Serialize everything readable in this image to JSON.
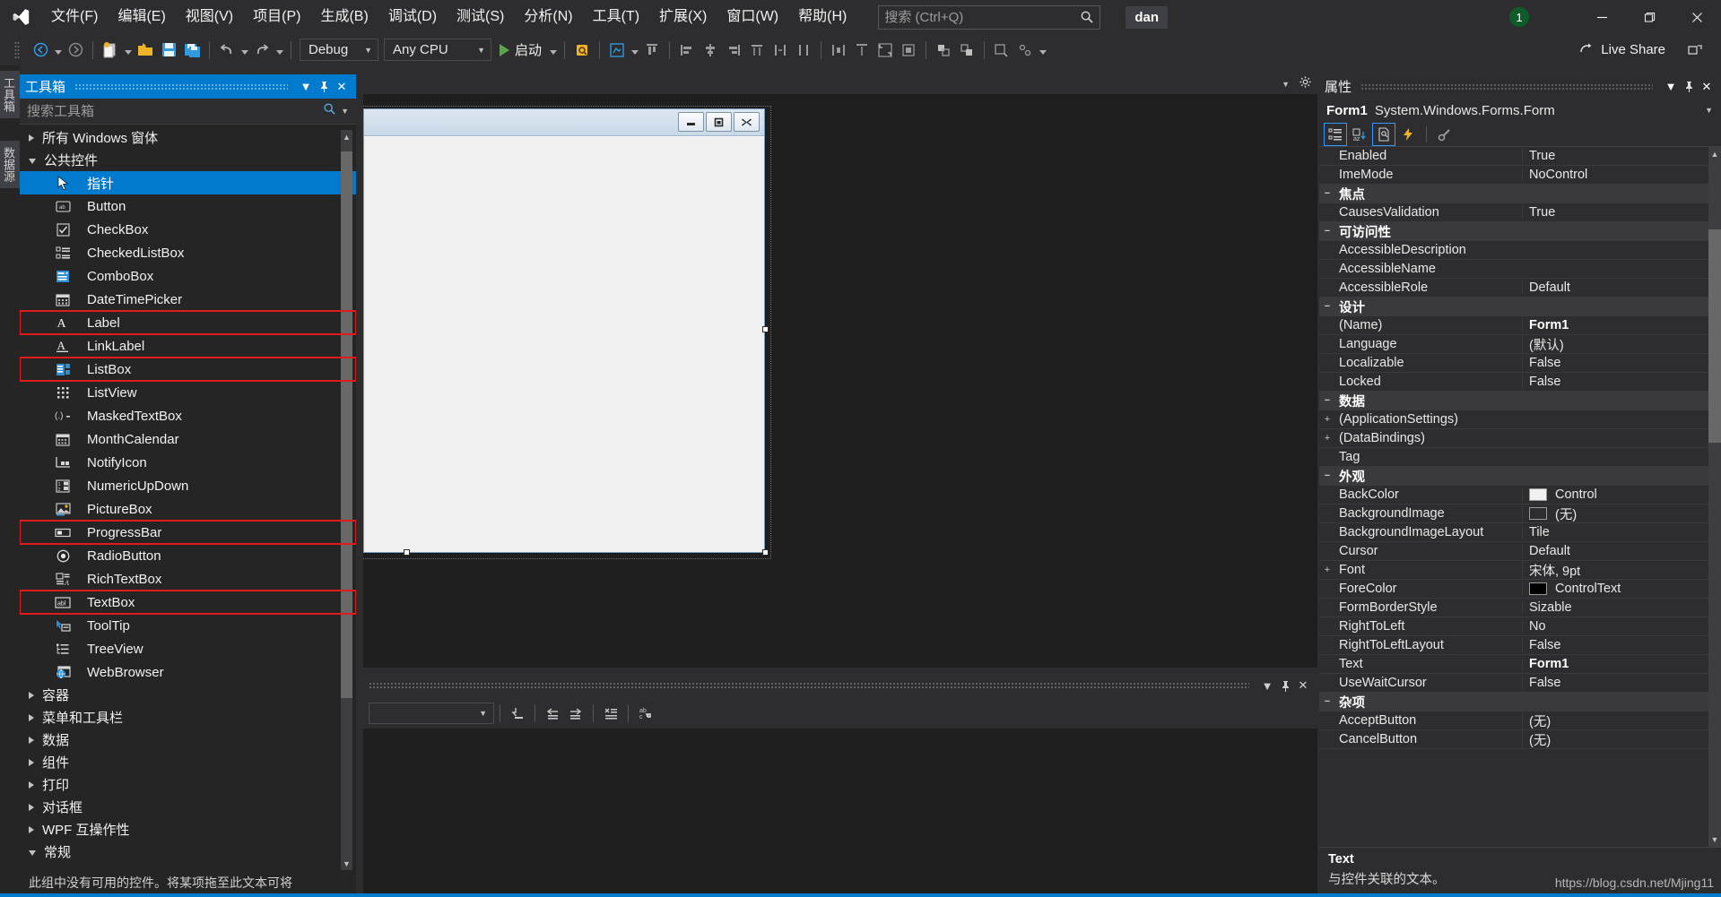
{
  "app": {
    "menu": [
      {
        "label": "文件(F)"
      },
      {
        "label": "编辑(E)"
      },
      {
        "label": "视图(V)"
      },
      {
        "label": "项目(P)"
      },
      {
        "label": "生成(B)"
      },
      {
        "label": "调试(D)"
      },
      {
        "label": "测试(S)"
      },
      {
        "label": "分析(N)"
      },
      {
        "label": "工具(T)"
      },
      {
        "label": "扩展(X)"
      },
      {
        "label": "窗口(W)"
      },
      {
        "label": "帮助(H)"
      }
    ],
    "search_placeholder": "搜索 (Ctrl+Q)",
    "user": "dan",
    "notification_count": "1",
    "window_buttons": {
      "minimize": "minimize-icon",
      "maximize": "maximize-icon",
      "close": "close-icon"
    }
  },
  "toolbar": {
    "configuration": "Debug",
    "platform": "Any CPU",
    "run_label": "启动",
    "live_share": "Live Share"
  },
  "vertical_tabs": [
    {
      "label": "工具箱"
    },
    {
      "label": "数据源"
    }
  ],
  "toolbox": {
    "title": "工具箱",
    "search_placeholder": "搜索工具箱",
    "groups": [
      {
        "label": "所有 Windows 窗体",
        "expanded": false
      },
      {
        "label": "公共控件",
        "expanded": true
      }
    ],
    "items": [
      {
        "label": "指针",
        "icon": "pointer-icon",
        "selected": true,
        "highlighted": false
      },
      {
        "label": "Button",
        "icon": "button-icon",
        "selected": false,
        "highlighted": false
      },
      {
        "label": "CheckBox",
        "icon": "checkbox-icon",
        "selected": false,
        "highlighted": false
      },
      {
        "label": "CheckedListBox",
        "icon": "checkedlistbox-icon",
        "selected": false,
        "highlighted": false
      },
      {
        "label": "ComboBox",
        "icon": "combobox-icon",
        "selected": false,
        "highlighted": false
      },
      {
        "label": "DateTimePicker",
        "icon": "datetimepicker-icon",
        "selected": false,
        "highlighted": false
      },
      {
        "label": "Label",
        "icon": "label-icon",
        "selected": false,
        "highlighted": true
      },
      {
        "label": "LinkLabel",
        "icon": "linklabel-icon",
        "selected": false,
        "highlighted": false
      },
      {
        "label": "ListBox",
        "icon": "listbox-icon",
        "selected": false,
        "highlighted": true
      },
      {
        "label": "ListView",
        "icon": "listview-icon",
        "selected": false,
        "highlighted": false
      },
      {
        "label": "MaskedTextBox",
        "icon": "maskedtextbox-icon",
        "selected": false,
        "highlighted": false
      },
      {
        "label": "MonthCalendar",
        "icon": "monthcalendar-icon",
        "selected": false,
        "highlighted": false
      },
      {
        "label": "NotifyIcon",
        "icon": "notifyicon-icon",
        "selected": false,
        "highlighted": false
      },
      {
        "label": "NumericUpDown",
        "icon": "numericupdown-icon",
        "selected": false,
        "highlighted": false
      },
      {
        "label": "PictureBox",
        "icon": "picturebox-icon",
        "selected": false,
        "highlighted": false
      },
      {
        "label": "ProgressBar",
        "icon": "progressbar-icon",
        "selected": false,
        "highlighted": true
      },
      {
        "label": "RadioButton",
        "icon": "radiobutton-icon",
        "selected": false,
        "highlighted": false
      },
      {
        "label": "RichTextBox",
        "icon": "richtextbox-icon",
        "selected": false,
        "highlighted": false
      },
      {
        "label": "TextBox",
        "icon": "textbox-icon",
        "selected": false,
        "highlighted": true
      },
      {
        "label": "ToolTip",
        "icon": "tooltip-icon",
        "selected": false,
        "highlighted": false
      },
      {
        "label": "TreeView",
        "icon": "treeview-icon",
        "selected": false,
        "highlighted": false
      },
      {
        "label": "WebBrowser",
        "icon": "webbrowser-icon",
        "selected": false,
        "highlighted": false
      }
    ],
    "trailing_groups": [
      {
        "label": "容器",
        "expanded": false
      },
      {
        "label": "菜单和工具栏",
        "expanded": false
      },
      {
        "label": "数据",
        "expanded": false
      },
      {
        "label": "组件",
        "expanded": false
      },
      {
        "label": "打印",
        "expanded": false
      },
      {
        "label": "对话框",
        "expanded": false
      },
      {
        "label": "WPF 互操作性",
        "expanded": false
      },
      {
        "label": "常规",
        "expanded": true
      }
    ],
    "footer_text": "此组中没有可用的控件。将某项拖至此文本可将"
  },
  "designer": {
    "form_title": "",
    "caption_buttons": [
      "minimize-icon",
      "maximize-icon",
      "close-icon"
    ]
  },
  "properties": {
    "title": "属性",
    "object_name": "Form1",
    "object_type": "System.Windows.Forms.Form",
    "tool_buttons": [
      {
        "name": "categorized-icon",
        "active": true
      },
      {
        "name": "alphabetical-icon",
        "active": false
      },
      {
        "name": "properties-page-icon",
        "active": true
      },
      {
        "name": "events-icon",
        "active": false
      },
      {
        "name": "property-pages-icon",
        "active": false
      }
    ],
    "rows": [
      {
        "kind": "prop",
        "name": "Enabled",
        "value": "True",
        "expander": "",
        "bold": false
      },
      {
        "kind": "prop",
        "name": "ImeMode",
        "value": "NoControl",
        "expander": "",
        "bold": false
      },
      {
        "kind": "cat",
        "name": "焦点",
        "value": "",
        "expander": "−",
        "bold": true
      },
      {
        "kind": "prop",
        "name": "CausesValidation",
        "value": "True",
        "expander": "",
        "bold": false
      },
      {
        "kind": "cat",
        "name": "可访问性",
        "value": "",
        "expander": "−",
        "bold": true
      },
      {
        "kind": "prop",
        "name": "AccessibleDescription",
        "value": "",
        "expander": "",
        "bold": false
      },
      {
        "kind": "prop",
        "name": "AccessibleName",
        "value": "",
        "expander": "",
        "bold": false
      },
      {
        "kind": "prop",
        "name": "AccessibleRole",
        "value": "Default",
        "expander": "",
        "bold": false
      },
      {
        "kind": "cat",
        "name": "设计",
        "value": "",
        "expander": "−",
        "bold": true
      },
      {
        "kind": "prop",
        "name": "(Name)",
        "value": "Form1",
        "expander": "",
        "bold": true
      },
      {
        "kind": "prop",
        "name": "Language",
        "value": "(默认)",
        "expander": "",
        "bold": false
      },
      {
        "kind": "prop",
        "name": "Localizable",
        "value": "False",
        "expander": "",
        "bold": false
      },
      {
        "kind": "prop",
        "name": "Locked",
        "value": "False",
        "expander": "",
        "bold": false
      },
      {
        "kind": "cat",
        "name": "数据",
        "value": "",
        "expander": "−",
        "bold": true
      },
      {
        "kind": "prop",
        "name": "(ApplicationSettings)",
        "value": "",
        "expander": "+",
        "bold": false
      },
      {
        "kind": "prop",
        "name": "(DataBindings)",
        "value": "",
        "expander": "+",
        "bold": false
      },
      {
        "kind": "prop",
        "name": "Tag",
        "value": "",
        "expander": "",
        "bold": false
      },
      {
        "kind": "cat",
        "name": "外观",
        "value": "",
        "expander": "−",
        "bold": true
      },
      {
        "kind": "prop",
        "name": "BackColor",
        "value": "Control",
        "expander": "",
        "bold": false,
        "swatch": "#f0f0f0"
      },
      {
        "kind": "prop",
        "name": "BackgroundImage",
        "value": "(无)",
        "expander": "",
        "bold": false,
        "swatch": "#2d2d30"
      },
      {
        "kind": "prop",
        "name": "BackgroundImageLayout",
        "value": "Tile",
        "expander": "",
        "bold": false
      },
      {
        "kind": "prop",
        "name": "Cursor",
        "value": "Default",
        "expander": "",
        "bold": false
      },
      {
        "kind": "prop",
        "name": "Font",
        "value": "宋体, 9pt",
        "expander": "+",
        "bold": false
      },
      {
        "kind": "prop",
        "name": "ForeColor",
        "value": "ControlText",
        "expander": "",
        "bold": false,
        "swatch": "#000000"
      },
      {
        "kind": "prop",
        "name": "FormBorderStyle",
        "value": "Sizable",
        "expander": "",
        "bold": false
      },
      {
        "kind": "prop",
        "name": "RightToLeft",
        "value": "No",
        "expander": "",
        "bold": false
      },
      {
        "kind": "prop",
        "name": "RightToLeftLayout",
        "value": "False",
        "expander": "",
        "bold": false
      },
      {
        "kind": "prop",
        "name": "Text",
        "value": "Form1",
        "expander": "",
        "bold": true
      },
      {
        "kind": "prop",
        "name": "UseWaitCursor",
        "value": "False",
        "expander": "",
        "bold": false
      },
      {
        "kind": "cat",
        "name": "杂项",
        "value": "",
        "expander": "−",
        "bold": true
      },
      {
        "kind": "prop",
        "name": "AcceptButton",
        "value": "(无)",
        "expander": "",
        "bold": false
      },
      {
        "kind": "prop",
        "name": "CancelButton",
        "value": "(无)",
        "expander": "",
        "bold": false
      }
    ],
    "description_title": "Text",
    "description_text": "与控件关联的文本。"
  },
  "watermark": "https://blog.csdn.net/Mjing11",
  "colors": {
    "accent": "#007acc",
    "highlight_red": "#e01b1b",
    "panel_bg": "#252526",
    "window_bg": "#2d2d30",
    "designer_bg": "#1e1e1e",
    "run_green": "#57a64a",
    "badge_green": "#0d5c2a"
  }
}
